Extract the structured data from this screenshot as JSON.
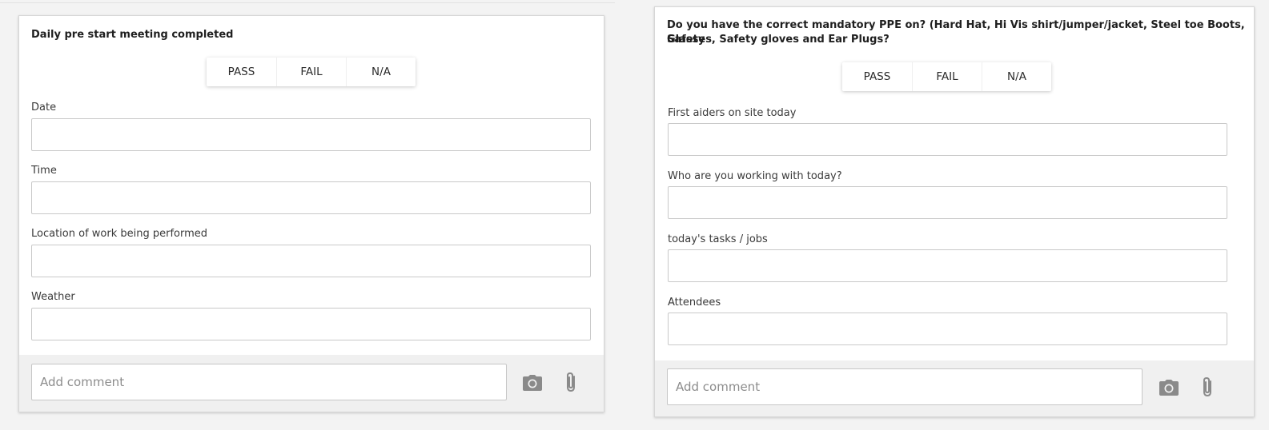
{
  "segment_options": [
    "PASS",
    "FAIL",
    "N/A"
  ],
  "comment_placeholder": "Add comment",
  "icons": {
    "camera": "camera-icon",
    "attach": "paperclip-icon"
  },
  "colors": {
    "icon": "#8a8a8a",
    "footer": "#f0f0f0",
    "border": "#c9c9c9"
  },
  "left_card": {
    "question": "Daily pre start meeting completed",
    "fields": [
      {
        "label": "Date",
        "value": ""
      },
      {
        "label": "Time",
        "value": ""
      },
      {
        "label": "Location of work being performed",
        "value": ""
      },
      {
        "label": "Weather",
        "value": ""
      }
    ]
  },
  "right_card": {
    "question_line1": "Do you have the correct mandatory PPE on? (Hard Hat, Hi Vis shirt/jumper/jacket, Steel toe Boots, Safety",
    "question_line2": "Glasses, Safety gloves and Ear Plugs?",
    "fields": [
      {
        "label": "First aiders on site today",
        "value": ""
      },
      {
        "label": "Who are you working with today?",
        "value": ""
      },
      {
        "label": "today's tasks / jobs",
        "value": ""
      },
      {
        "label": "Attendees",
        "value": ""
      }
    ]
  }
}
